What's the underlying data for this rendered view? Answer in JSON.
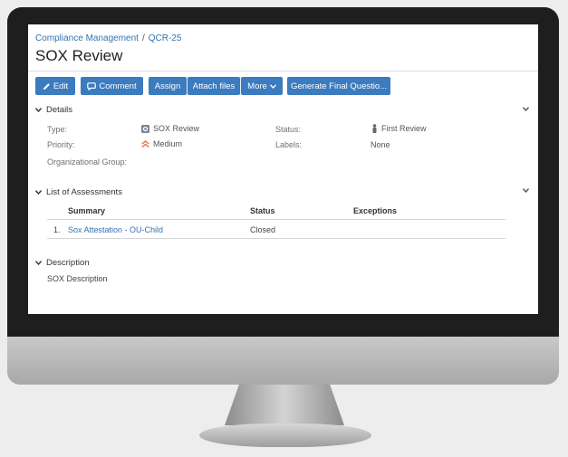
{
  "breadcrumb": {
    "project": "Compliance Management",
    "separator": "/",
    "issue_key": "QCR-25"
  },
  "page_title": "SOX Review",
  "toolbar": {
    "edit": "Edit",
    "comment": "Comment",
    "assign": "Assign",
    "attach": "Attach files",
    "more": "More",
    "generate": "Generate Final Questio..."
  },
  "details": {
    "heading": "Details",
    "type_label": "Type:",
    "type_value": "SOX Review",
    "status_label": "Status:",
    "status_value": "First Review",
    "priority_label": "Priority:",
    "priority_value": "Medium",
    "labels_label": "Labels:",
    "labels_value": "None",
    "org_group_label": "Organizational Group:"
  },
  "assessments": {
    "heading": "List of Assessments",
    "columns": {
      "summary": "Summary",
      "status": "Status",
      "exceptions": "Exceptions"
    },
    "rows": [
      {
        "index": "1.",
        "summary": "Sox Attestation - OU-Child",
        "status": "Closed",
        "exceptions": ""
      }
    ]
  },
  "description": {
    "heading": "Description",
    "text": "SOX Description"
  },
  "colors": {
    "link": "#3572b0",
    "button": "#3b7bbf",
    "priority": "#e8643c",
    "bezel": "#1e1e1e"
  },
  "icons": {
    "edit": "pencil-icon",
    "comment": "speech-bubble-icon",
    "more": "caret-down-icon",
    "type": "issue-type-icon",
    "status": "person-icon",
    "priority": "priority-medium-icon",
    "section": "chevron-down-icon"
  }
}
